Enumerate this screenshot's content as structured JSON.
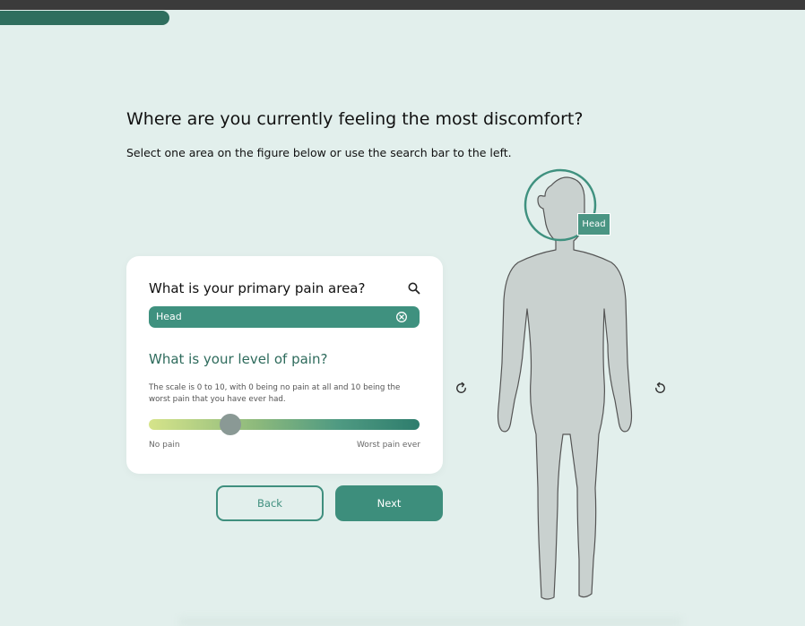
{
  "progress": {
    "value_percent": 21
  },
  "question": {
    "title": "Where are you currently feeling the most discomfort?",
    "subtitle": "Select one area on the figure below or use the search bar to the left."
  },
  "card": {
    "primary_question": "What is your primary pain area?",
    "search_icon": "search-icon",
    "selected_area": "Head",
    "clear_icon": "clear-circle-icon",
    "level_question": "What is your level of pain?",
    "level_description": "The scale is 0 to 10, with 0 being no pain at all and 10 being the worst pain that you have ever had.",
    "slider": {
      "min": 0,
      "max": 10,
      "value": 3
    },
    "min_label": "No pain",
    "max_label": "Worst pain ever"
  },
  "buttons": {
    "back_label": "Back",
    "next_label": "Next"
  },
  "figure": {
    "highlight_label": "Head",
    "rotate_left_icon": "rotate-clockwise-icon",
    "rotate_right_icon": "rotate-counterclockwise-icon"
  },
  "colors": {
    "background": "#e2efec",
    "accent": "#3f917f",
    "accent_dark": "#2f6e5e",
    "figure_fill": "#c9d1cf",
    "figure_stroke": "#555555"
  }
}
